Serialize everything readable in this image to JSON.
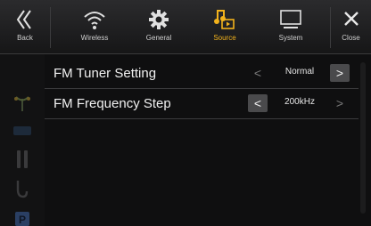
{
  "header": {
    "back": {
      "label": "Back",
      "icon": "back-icon"
    },
    "tabs": [
      {
        "label": "Wireless",
        "icon": "wireless-icon",
        "active": false
      },
      {
        "label": "General",
        "icon": "gear-icon",
        "active": false
      },
      {
        "label": "Source",
        "icon": "music-source-icon",
        "active": true
      },
      {
        "label": "System",
        "icon": "monitor-icon",
        "active": false
      }
    ],
    "close": {
      "label": "Close",
      "icon": "close-icon"
    }
  },
  "settings": [
    {
      "label": "FM Tuner Setting",
      "value": "Normal",
      "left_enabled": false,
      "right_enabled": true
    },
    {
      "label": "FM Frequency Step",
      "value": "200kHz",
      "left_enabled": true,
      "right_enabled": false
    }
  ],
  "sidebar_icons": [
    "antenna-icon",
    "tuner-icon",
    "usb-icon",
    "cable-icon",
    "parking-icon"
  ],
  "colors": {
    "accent": "#f2b21c",
    "background": "#0f0f10",
    "button": "#4a4a4c"
  }
}
